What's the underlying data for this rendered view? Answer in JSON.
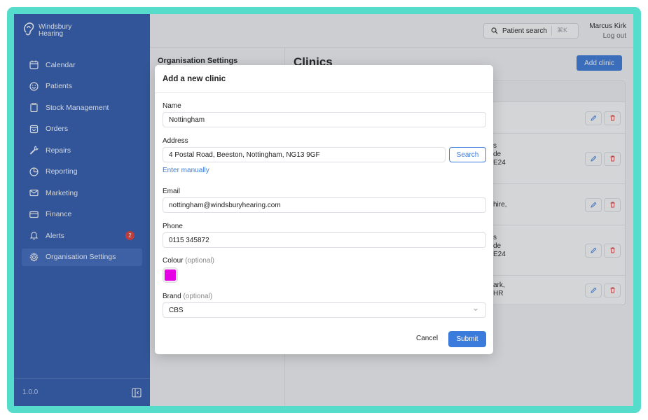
{
  "brand": {
    "name_line1": "Windsbury",
    "name_line2": "Hearing",
    "logo_icon": "ear-icon"
  },
  "sidebar": {
    "items": [
      {
        "label": "Calendar",
        "icon": "calendar-icon"
      },
      {
        "label": "Patients",
        "icon": "smiley-icon"
      },
      {
        "label": "Stock Management",
        "icon": "clipboard-icon"
      },
      {
        "label": "Orders",
        "icon": "bag-icon"
      },
      {
        "label": "Repairs",
        "icon": "wrench-icon"
      },
      {
        "label": "Reporting",
        "icon": "pie-chart-icon"
      },
      {
        "label": "Marketing",
        "icon": "envelope-icon"
      },
      {
        "label": "Finance",
        "icon": "card-icon"
      },
      {
        "label": "Alerts",
        "icon": "bell-icon",
        "badge": "2"
      },
      {
        "label": "Organisation Settings",
        "icon": "gear-icon",
        "active": true
      }
    ],
    "version": "1.0.0"
  },
  "topbar": {
    "search_label": "Patient search",
    "search_shortcut": "⌘K",
    "user_name": "Marcus Kirk",
    "logout_label": "Log out"
  },
  "settings_panel": {
    "title": "Organisation Settings"
  },
  "main": {
    "title": "Clinics",
    "add_button": "Add clinic",
    "rows": [
      {
        "addr": []
      },
      {
        "addr": [
          "s",
          "de",
          "E24"
        ]
      },
      {
        "addr": [
          "hire,"
        ]
      },
      {
        "addr": [
          "s",
          "de",
          "E24"
        ]
      },
      {
        "addr": [
          "ark,",
          "HR"
        ]
      }
    ]
  },
  "modal": {
    "title": "Add a new clinic",
    "name_label": "Name",
    "name_value": "Nottingham",
    "address_label": "Address",
    "address_value": "4 Postal Road, Beeston, Nottingham, NG13 9GF",
    "search_button": "Search",
    "enter_manually": "Enter manually",
    "email_label": "Email",
    "email_value": "nottingham@windsburyhearing.com",
    "phone_label": "Phone",
    "phone_value": "0115 345872",
    "colour_label": "Colour",
    "colour_optional": "(optional)",
    "colour_value": "#e600e6",
    "brand_label": "Brand",
    "brand_optional": "(optional)",
    "brand_value": "CBS",
    "cancel_button": "Cancel",
    "submit_button": "Submit"
  },
  "colors": {
    "sidebar": "#2f5bb0",
    "accent": "#3a7bdc",
    "frame": "#55dccb",
    "badge": "#e23b3b"
  }
}
